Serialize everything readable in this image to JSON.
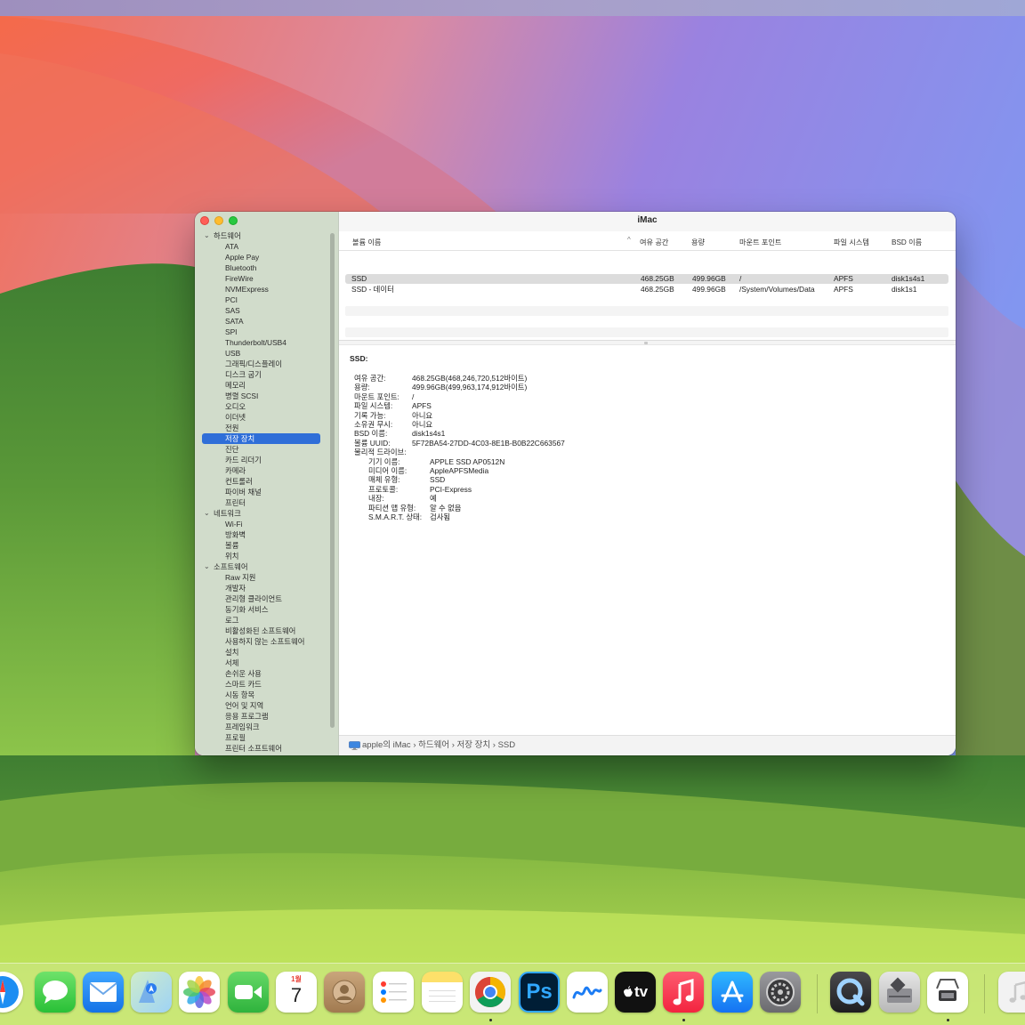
{
  "window": {
    "title": "iMac"
  },
  "sidebar": {
    "items": [
      {
        "label": "하드웨어",
        "kind": "section"
      },
      {
        "label": "ATA",
        "kind": "child"
      },
      {
        "label": "Apple Pay",
        "kind": "child"
      },
      {
        "label": "Bluetooth",
        "kind": "child"
      },
      {
        "label": "FireWire",
        "kind": "child"
      },
      {
        "label": "NVMExpress",
        "kind": "child"
      },
      {
        "label": "PCI",
        "kind": "child"
      },
      {
        "label": "SAS",
        "kind": "child"
      },
      {
        "label": "SATA",
        "kind": "child"
      },
      {
        "label": "SPI",
        "kind": "child"
      },
      {
        "label": "Thunderbolt/USB4",
        "kind": "child"
      },
      {
        "label": "USB",
        "kind": "child"
      },
      {
        "label": "그래픽/디스플레이",
        "kind": "child"
      },
      {
        "label": "디스크 굽기",
        "kind": "child"
      },
      {
        "label": "메모리",
        "kind": "child"
      },
      {
        "label": "병렬 SCSI",
        "kind": "child"
      },
      {
        "label": "오디오",
        "kind": "child"
      },
      {
        "label": "이더넷",
        "kind": "child"
      },
      {
        "label": "전원",
        "kind": "child"
      },
      {
        "label": "저장 장치",
        "kind": "child",
        "selected": true
      },
      {
        "label": "진단",
        "kind": "child"
      },
      {
        "label": "카드 리더기",
        "kind": "child"
      },
      {
        "label": "카메라",
        "kind": "child"
      },
      {
        "label": "컨트롤러",
        "kind": "child"
      },
      {
        "label": "파이버 채널",
        "kind": "child"
      },
      {
        "label": "프린터",
        "kind": "child"
      },
      {
        "label": "네트워크",
        "kind": "section"
      },
      {
        "label": "Wi-Fi",
        "kind": "child"
      },
      {
        "label": "방화벽",
        "kind": "child"
      },
      {
        "label": "볼륨",
        "kind": "child"
      },
      {
        "label": "위치",
        "kind": "child"
      },
      {
        "label": "소프트웨어",
        "kind": "section"
      },
      {
        "label": "Raw 지원",
        "kind": "child"
      },
      {
        "label": "개발자",
        "kind": "child"
      },
      {
        "label": "관리형 클라이언트",
        "kind": "child"
      },
      {
        "label": "동기화 서비스",
        "kind": "child"
      },
      {
        "label": "로그",
        "kind": "child"
      },
      {
        "label": "비활성화된 소프트웨어",
        "kind": "child"
      },
      {
        "label": "사용하지 않는 소프트웨어",
        "kind": "child"
      },
      {
        "label": "설치",
        "kind": "child"
      },
      {
        "label": "서체",
        "kind": "child"
      },
      {
        "label": "손쉬운 사용",
        "kind": "child"
      },
      {
        "label": "스마트 카드",
        "kind": "child"
      },
      {
        "label": "시동 항목",
        "kind": "child"
      },
      {
        "label": "언어 및 지역",
        "kind": "child"
      },
      {
        "label": "응용 프로그램",
        "kind": "child"
      },
      {
        "label": "프레임워크",
        "kind": "child"
      },
      {
        "label": "프로필",
        "kind": "child"
      },
      {
        "label": "프린터 소프트웨어",
        "kind": "child"
      }
    ]
  },
  "table": {
    "columns": [
      "볼륨 이름",
      "여유 공간",
      "용량",
      "마운트 포인트",
      "파일 시스템",
      "BSD 이름"
    ],
    "sort_indicator": "^",
    "rows": [
      {
        "name": "SSD",
        "free": "468.25GB",
        "capacity": "499.96GB",
        "mount": "/",
        "fs": "APFS",
        "bsd": "disk1s4s1"
      },
      {
        "name": "SSD - 데이터",
        "free": "468.25GB",
        "capacity": "499.96GB",
        "mount": "/System/Volumes/Data",
        "fs": "APFS",
        "bsd": "disk1s1"
      }
    ]
  },
  "detail": {
    "title": "SSD:",
    "fields": [
      {
        "k": "여유 공간:",
        "v": "468.25GB(468,246,720,512바이트)"
      },
      {
        "k": "용량:",
        "v": "499.96GB(499,963,174,912바이트)"
      },
      {
        "k": "마운트 포인트:",
        "v": "/"
      },
      {
        "k": "파일 시스템:",
        "v": "APFS"
      },
      {
        "k": "기록 가능:",
        "v": "아니요"
      },
      {
        "k": "소유권 무시:",
        "v": "아니요"
      },
      {
        "k": "BSD 이름:",
        "v": "disk1s4s1"
      },
      {
        "k": "볼륨 UUID:",
        "v": "5F72BA54-27DD-4C03-8E1B-B0B22C663567"
      },
      {
        "k": "물리적 드라이브:",
        "v": ""
      }
    ],
    "drive_fields": [
      {
        "k": "기기 이름:",
        "v": "APPLE SSD AP0512N"
      },
      {
        "k": "미디어 이름:",
        "v": "AppleAPFSMedia"
      },
      {
        "k": "매체 유형:",
        "v": "SSD"
      },
      {
        "k": "프로토콜:",
        "v": "PCI-Express"
      },
      {
        "k": "내장:",
        "v": "예"
      },
      {
        "k": "파티션 맵 유형:",
        "v": "알 수 없음"
      },
      {
        "k": "S.M.A.R.T. 상태:",
        "v": "검사됨"
      }
    ]
  },
  "statusbar": {
    "path": "apple의 iMac › 하드웨어 › 저장 장치 › SSD"
  },
  "dock": {
    "calendar_month": "1월",
    "calendar_day": "7",
    "photoshop_label": "Ps",
    "tv_label": "tv",
    "icons": [
      "safari-icon",
      "messages-icon",
      "mail-icon",
      "maps-icon",
      "photos-icon",
      "facetime-icon",
      "calendar-icon",
      "contacts-icon",
      "reminders-icon",
      "notes-icon",
      "chrome-icon",
      "photoshop-icon",
      "freeform-icon",
      "apple-tv-icon",
      "music-icon",
      "app-store-icon",
      "system-settings-icon",
      "quicktime-icon",
      "boot-camp-icon",
      "system-information-icon",
      "itunes-icon"
    ]
  }
}
